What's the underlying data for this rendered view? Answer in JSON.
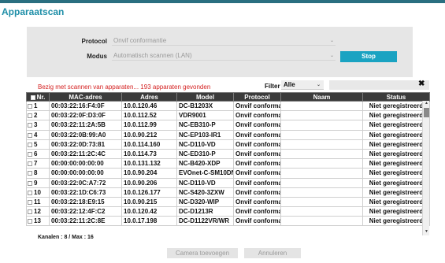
{
  "window": {
    "title": "Apparaatscan"
  },
  "form": {
    "protocol_label": "Protocol",
    "protocol_value": "Onvif conformantie",
    "mode_label": "Modus",
    "mode_value": "Automatisch scannen (LAN)",
    "stop_label": "Stop"
  },
  "status_message": "Bezig met scannen van apparaten... 193 apparaten gevonden",
  "filter": {
    "label": "Filter",
    "value": "Alle",
    "search_value": "",
    "clear_icon": "close-icon"
  },
  "table": {
    "columns": [
      "Nr.",
      "MAC-adres",
      "Adres",
      "Model",
      "Protocol",
      "Naam",
      "Status"
    ],
    "rows": [
      [
        "1",
        "00:03:22:16:F4:0F",
        "10.0.120.46",
        "DC-B1203X",
        "Onvif conforma",
        "",
        "Niet geregistreerd"
      ],
      [
        "2",
        "00:03:22:0F:D3:0F",
        "10.0.112.52",
        "VDR9001",
        "Onvif conforma",
        "",
        "Niet geregistreerd"
      ],
      [
        "3",
        "00:03:22:11:2A:5B",
        "10.0.112.99",
        "NC-EB310-P",
        "Onvif conforma",
        "",
        "Niet geregistreerd"
      ],
      [
        "4",
        "00:03:22:0B:99:A0",
        "10.0.90.212",
        "NC-EP103-IR1",
        "Onvif conforma",
        "",
        "Niet geregistreerd"
      ],
      [
        "5",
        "00:03:22:0D:73:81",
        "10.0.114.160",
        "NC-D110-VD",
        "Onvif conforma",
        "",
        "Niet geregistreerd"
      ],
      [
        "6",
        "00:03:22:11:2C:4C",
        "10.0.114.73",
        "NC-ED310-P",
        "Onvif conforma",
        "",
        "Niet geregistreerd"
      ],
      [
        "7",
        "00:00:00:00:00:00",
        "10.0.131.132",
        "NC-B420-XDP",
        "Onvif conforma",
        "",
        "Niet geregistreerd"
      ],
      [
        "8",
        "00:00:00:00:00:00",
        "10.0.90.204",
        "EVOnet-C-SM10DN",
        "Onvif conforma",
        "",
        "Niet geregistreerd"
      ],
      [
        "9",
        "00:03:22:0C:A7:72",
        "10.0.90.206",
        "NC-D110-VD",
        "Onvif conforma",
        "",
        "Niet geregistreerd"
      ],
      [
        "10",
        "00:03:22:1D:C6:73",
        "10.0.126.177",
        "NC-S420-3ZXW",
        "Onvif conforma",
        "",
        "Niet geregistreerd"
      ],
      [
        "11",
        "00:03:22:18:E9:15",
        "10.0.90.215",
        "NC-D320-WIP",
        "Onvif conforma",
        "",
        "Niet geregistreerd"
      ],
      [
        "12",
        "00:03:22:12:4F:C2",
        "10.0.120.42",
        "DC-D1213R",
        "Onvif conforma",
        "",
        "Niet geregistreerd"
      ],
      [
        "13",
        "00:03:22:11:2C:8E",
        "10.0.17.198",
        "DC-D1122VR/WR",
        "Onvif conforma",
        "",
        "Niet geregistreerd"
      ]
    ]
  },
  "channels_text": "Kanalen : 8 / Max : 16",
  "buttons": {
    "add_camera": "Camera toevoegen",
    "cancel": "Annuleren"
  },
  "colors": {
    "accent": "#1aa3c2",
    "title": "#1f8fa8",
    "header_bg": "#3b3b3b",
    "error": "#d42020"
  }
}
